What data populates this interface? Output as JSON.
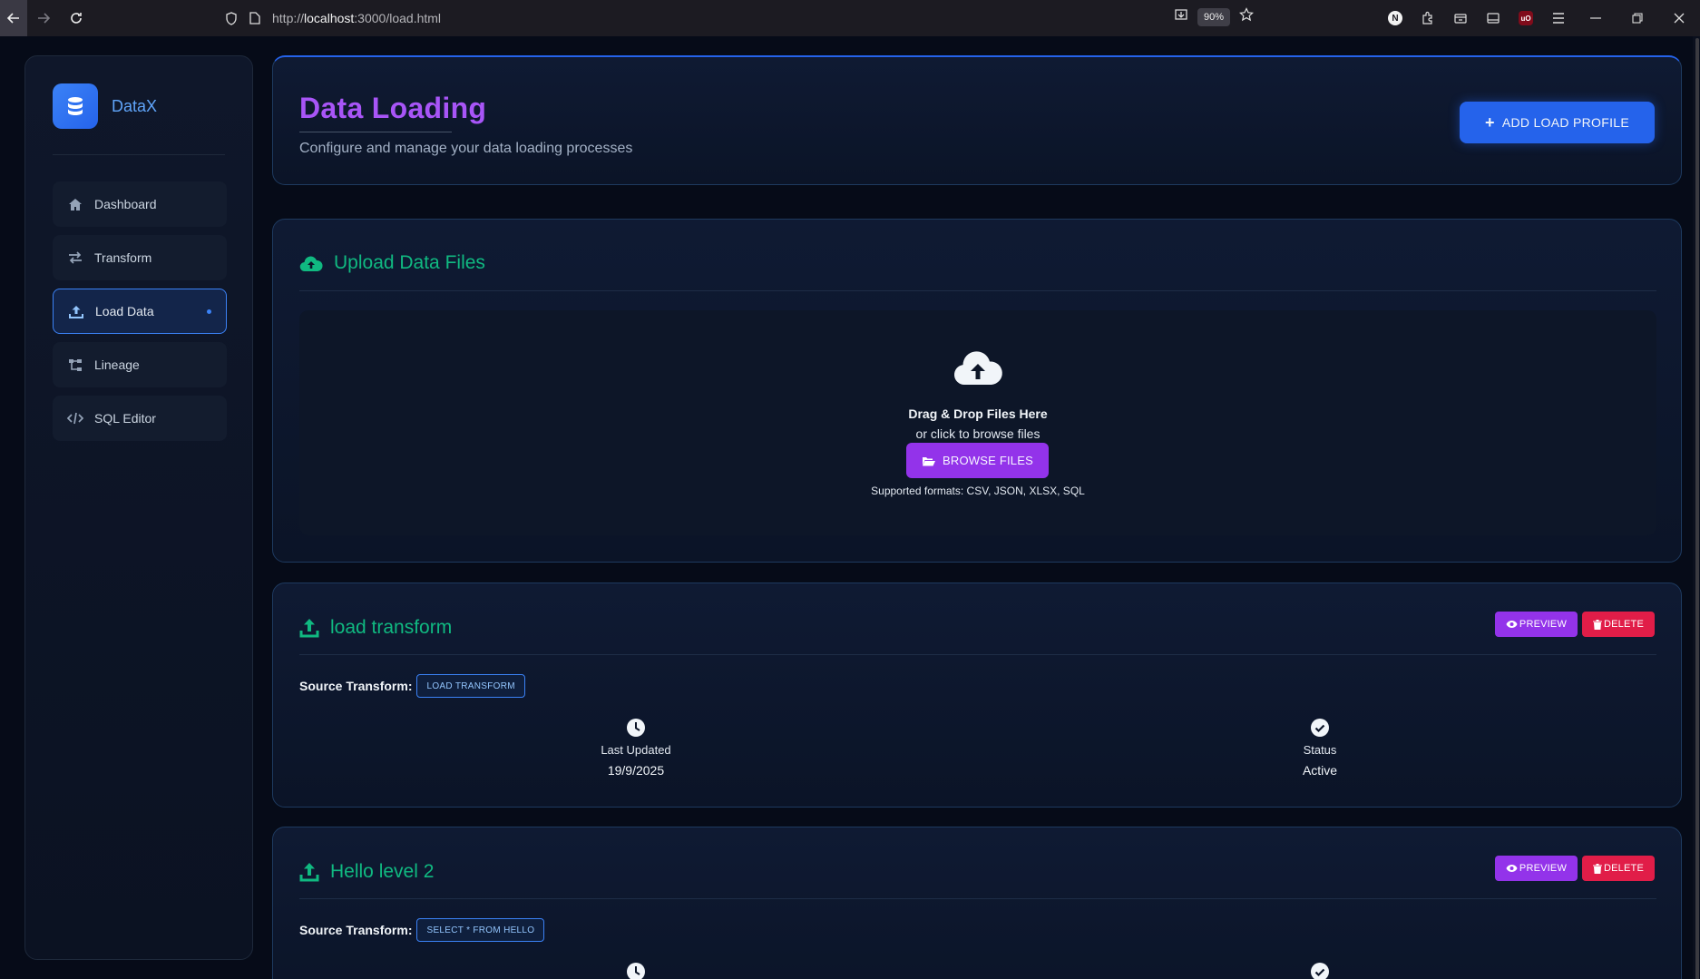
{
  "browser": {
    "url_prefix": "http://",
    "url_host": "localhost",
    "url_rest": ":3000/load.html",
    "zoom": "90%"
  },
  "sidebar": {
    "brand": "DataX",
    "items": [
      {
        "label": "Dashboard",
        "icon": "home-icon"
      },
      {
        "label": "Transform",
        "icon": "arrows-exchange-icon"
      },
      {
        "label": "Load Data",
        "icon": "upload-icon",
        "active": true
      },
      {
        "label": "Lineage",
        "icon": "lineage-icon"
      },
      {
        "label": "SQL Editor",
        "icon": "code-icon"
      }
    ]
  },
  "header": {
    "title": "Data Loading",
    "subtitle": "Configure and manage your data loading processes",
    "add_button": "ADD LOAD PROFILE"
  },
  "upload": {
    "title": "Upload Data Files",
    "drop_title": "Drag & Drop Files Here",
    "drop_sub": "or click to browse files",
    "browse_button": "BROWSE FILES",
    "formats": "Supported formats: CSV, JSON, XLSX, SQL"
  },
  "profiles": [
    {
      "name": "load transform",
      "preview": "PREVIEW",
      "delete": "DELETE",
      "source_label": "Source Transform:",
      "source": "LOAD TRANSFORM",
      "updated_label": "Last Updated",
      "updated": "19/9/2025",
      "status_label": "Status",
      "status": "Active"
    },
    {
      "name": "Hello level 2",
      "preview": "PREVIEW",
      "delete": "DELETE",
      "source_label": "Source Transform:",
      "source": "SELECT * FROM HELLO"
    }
  ],
  "colors": {
    "accent_purple": "#a855f7",
    "accent_green": "#10b981",
    "accent_blue": "#2563eb",
    "danger": "#e11d48"
  }
}
